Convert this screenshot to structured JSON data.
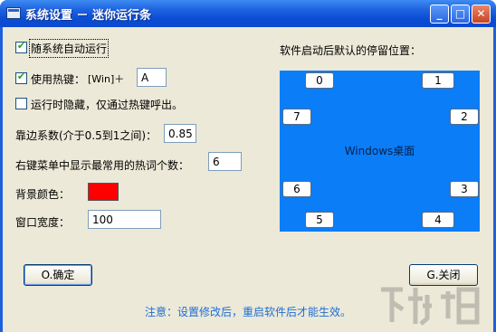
{
  "window": {
    "title": "系统设置 － 迷你运行条",
    "minimize_glyph": "_",
    "maximize_glyph": "□",
    "close_glyph": "✕"
  },
  "options": {
    "autostart_label": "随系统自动运行",
    "autostart_checked": true,
    "hotkey_label": "使用热键：",
    "hotkey_checked": true,
    "hotkey_modifier": "[Win]＋",
    "hotkey_key": "A",
    "hide_on_run_label": "运行时隐藏，仅通过热键呼出。",
    "hide_on_run_checked": false,
    "edge_coef_label": "靠边系数(介于0.5到1之间)：",
    "edge_coef_value": "0.85",
    "menu_hot_count_label": "右键菜单中显示最常用的热词个数：",
    "menu_hot_count_value": "6",
    "bg_color_label": "背景颜色：",
    "bg_color": "#ff0000",
    "window_width_label": "窗口宽度：",
    "window_width_value": "100"
  },
  "dock": {
    "heading": "软件启动后默认的停留位置：",
    "desktop_label": "Windows桌面",
    "desktop_color": "#0a7df7",
    "positions": [
      "0",
      "1",
      "7",
      "2",
      "6",
      "3",
      "5",
      "4"
    ],
    "selected": "1"
  },
  "buttons": {
    "ok_label": "O.确定",
    "close_label": "G.关闭"
  },
  "note": "注意：设置修改后，重启软件后才能生效。",
  "watermark": "下载吧"
}
